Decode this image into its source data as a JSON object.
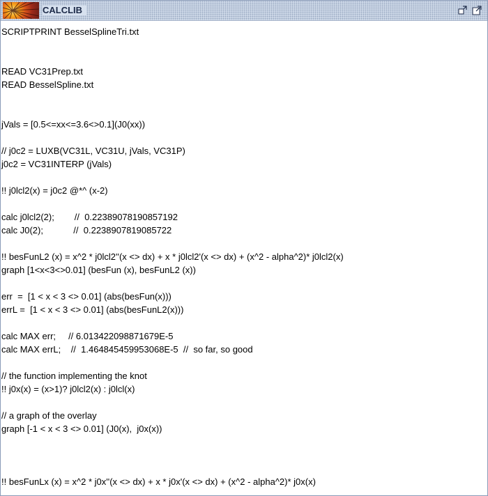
{
  "window": {
    "title": "CALCLIB",
    "buttons": [
      "restore-icon",
      "maximize-icon"
    ]
  },
  "script": {
    "lines": [
      "SCRIPTPRINT BesselSplineTri.txt",
      "",
      "",
      "READ VC31Prep.txt",
      "READ BesselSpline.txt",
      "",
      "",
      "jVals = [0.5<=xx<=3.6<>0.1](J0(xx))",
      "",
      "// j0c2 = LUXB(VC31L, VC31U, jVals, VC31P)",
      "j0c2 = VC31INTERP (jVals)",
      "",
      "!! j0lcl2(x) = j0c2 @*^ (x-2)",
      "",
      "calc j0lcl2(2);        //  0.22389078190857192",
      "calc J0(2);            //  0.2238907819085722",
      "",
      "!! besFunL2 (x) = x^2 * j0lcl2''(x <> dx) + x * j0lcl2'(x <> dx) + (x^2 - alpha^2)* j0lcl2(x)",
      "graph [1<x<3<>0.01] (besFun (x), besFunL2 (x))",
      "",
      "err  =  [1 < x < 3 <> 0.01] (abs(besFun(x)))",
      "errL =  [1 < x < 3 <> 0.01] (abs(besFunL2(x)))",
      "",
      "calc MAX err;     // 6.013422098871679E-5",
      "calc MAX errL;    //  1.464845459953068E-5  //  so far, so good",
      "",
      "// the function implementing the knot",
      "!! j0x(x) = (x>1)? j0lcl2(x) : j0lcl(x)",
      "",
      "// a graph of the overlay",
      "graph [-1 < x < 3 <> 0.01] (J0(x),  j0x(x))",
      "",
      "",
      "",
      "!! besFunLx (x) = x^2 * j0x''(x <> dx) + x * j0x'(x <> dx) + (x^2 - alpha^2)* j0x(x)"
    ]
  }
}
